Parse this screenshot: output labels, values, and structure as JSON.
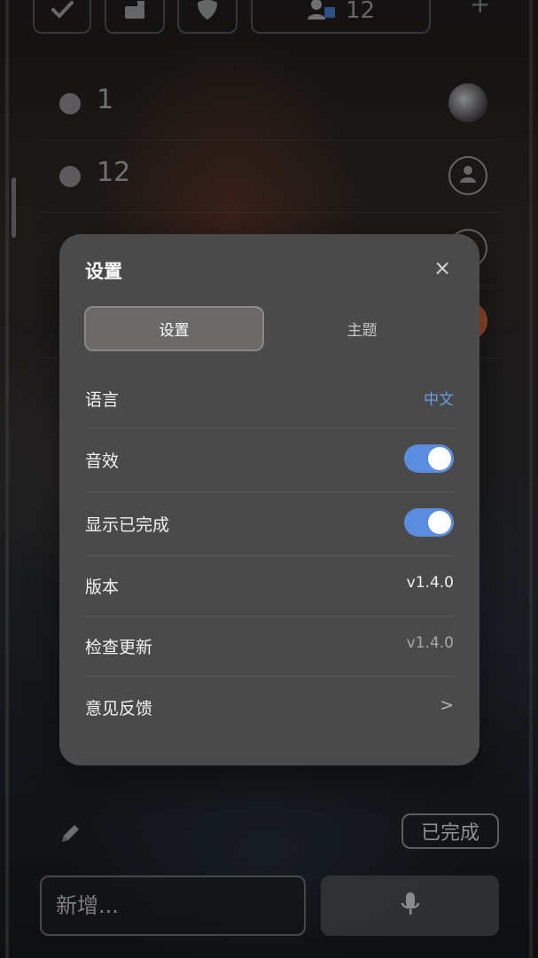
{
  "topbar": {
    "group_count": "12",
    "plus": "+"
  },
  "rows": [
    {
      "label": "1",
      "avatar": "photo"
    },
    {
      "label": "12",
      "avatar": "default"
    },
    {
      "label": "",
      "avatar": "default"
    },
    {
      "label": "",
      "avatar": "orange"
    }
  ],
  "dialog": {
    "title": "设置",
    "close": "×",
    "tabs": [
      {
        "label": "设置",
        "active": true
      },
      {
        "label": "主题",
        "active": false
      }
    ],
    "settings": {
      "language": {
        "label": "语言",
        "value": "中文"
      },
      "sound": {
        "label": "音效",
        "enabled": true
      },
      "show_completed": {
        "label": "显示已完成",
        "enabled": true
      },
      "version": {
        "label": "版本",
        "value": "v1.4.0"
      },
      "check_update": {
        "label": "检查更新",
        "value": "v1.4.0"
      },
      "feedback": {
        "label": "意见反馈",
        "value": ">"
      }
    }
  },
  "bottom": {
    "completed_label": "已完成",
    "new_placeholder": "新增..."
  },
  "colors": {
    "accent": "#5a8ddf",
    "link": "#6a9be3",
    "dialog_bg": "#4a4a4b"
  }
}
